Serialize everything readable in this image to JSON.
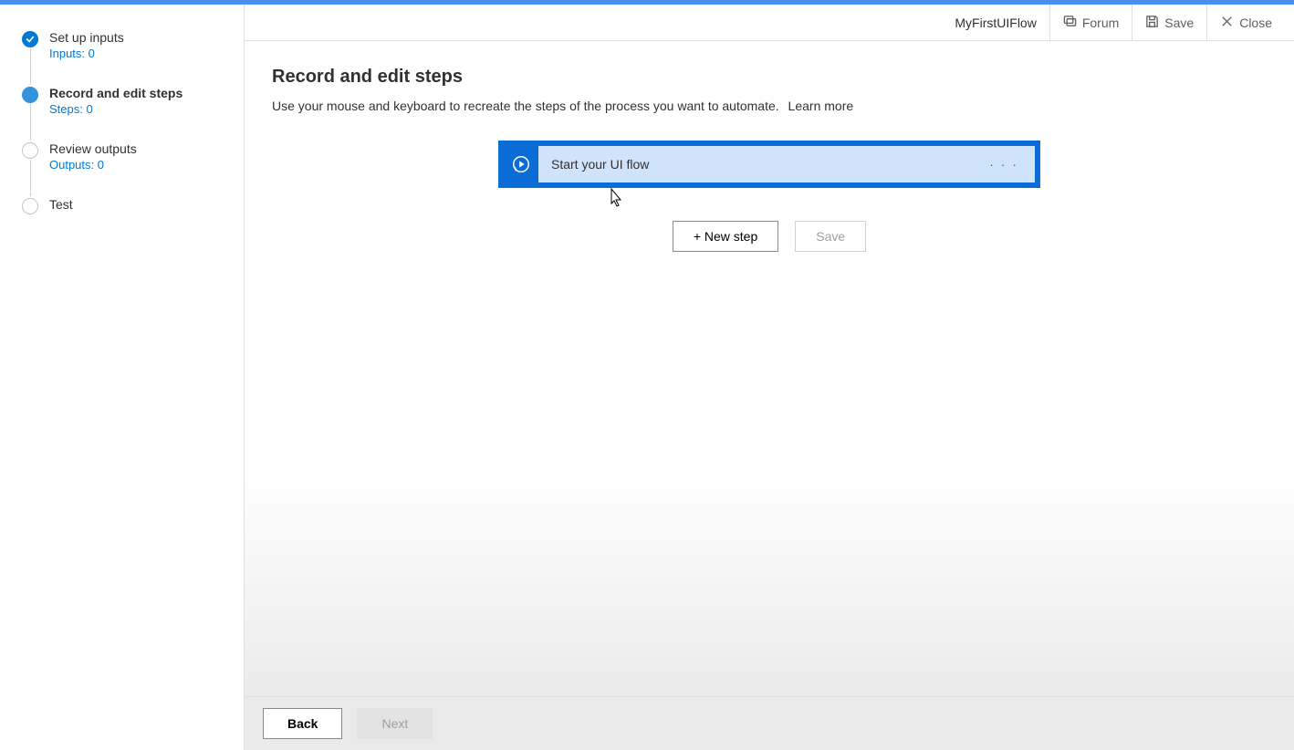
{
  "header": {
    "flow_name": "MyFirstUIFlow",
    "forum": "Forum",
    "save": "Save",
    "close": "Close"
  },
  "sidebar": {
    "steps": [
      {
        "title": "Set up inputs",
        "sub": "Inputs: 0",
        "state": "done"
      },
      {
        "title": "Record and edit steps",
        "sub": "Steps: 0",
        "state": "active"
      },
      {
        "title": "Review outputs",
        "sub": "Outputs: 0",
        "state": "pending"
      },
      {
        "title": "Test",
        "sub": "",
        "state": "pending"
      }
    ]
  },
  "page": {
    "title": "Record and edit steps",
    "description": "Use your mouse and keyboard to recreate the steps of the process you want to automate.",
    "learn_more": "Learn more"
  },
  "flow_card": {
    "label": "Start your UI flow"
  },
  "buttons": {
    "new_step": "+ New step",
    "save": "Save"
  },
  "footer": {
    "back": "Back",
    "next": "Next"
  }
}
